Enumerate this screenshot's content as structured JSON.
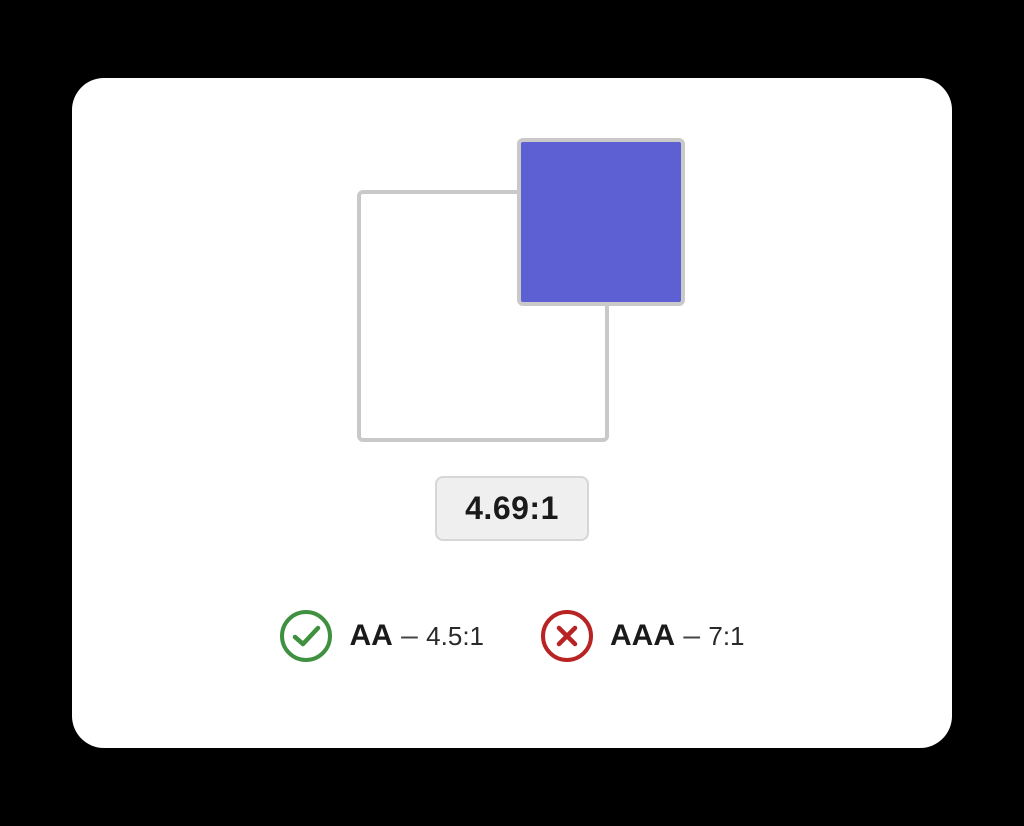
{
  "colors": {
    "background": "#ffffff",
    "foreground": "#5c60d2",
    "border": "#c9c9c9",
    "pass": "#3f9140",
    "fail": "#b82424"
  },
  "contrast_ratio_label": "4.69:1",
  "compliance": {
    "aa": {
      "level": "AA",
      "separator": " – ",
      "requirement": "4.5:1",
      "pass": true
    },
    "aaa": {
      "level": "AAA",
      "separator": " – ",
      "requirement": "7:1",
      "pass": false
    }
  }
}
